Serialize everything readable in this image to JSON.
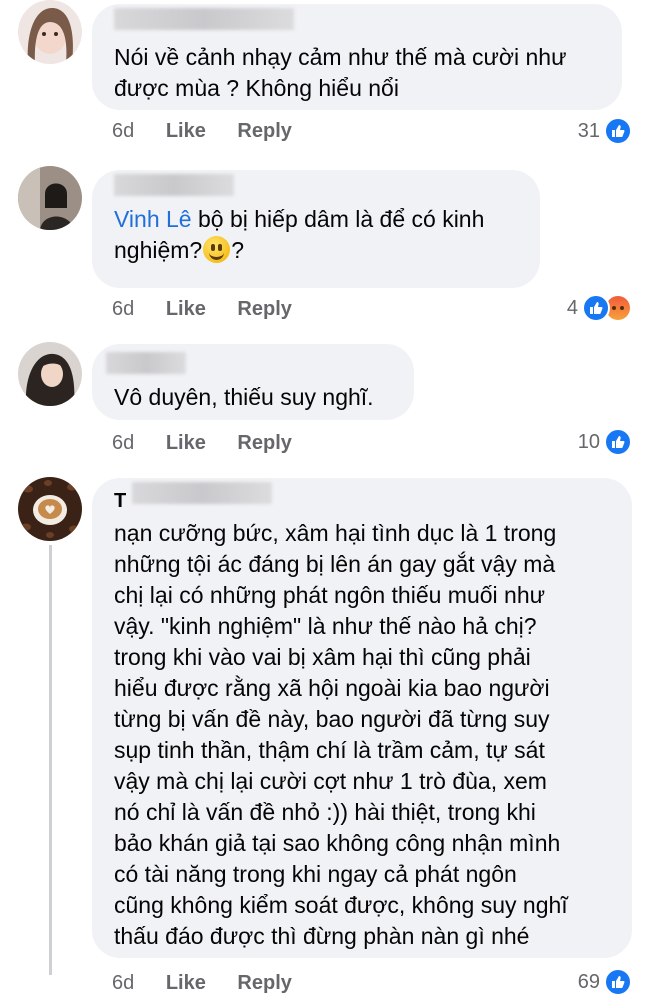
{
  "comments": [
    {
      "text": "Nói về cảnh nhạy cảm như thế mà cười như\nđược mùa ? Không hiểu nổi",
      "time": "6d",
      "like_label": "Like",
      "reply_label": "Reply",
      "reaction_count": "31"
    },
    {
      "mention": "Vinh Lê",
      "text_a": " bộ bị hiếp dâm là để có kinh\nnghiệm?",
      "text_b": "?",
      "time": "6d",
      "like_label": "Like",
      "reply_label": "Reply",
      "reaction_count": "4"
    },
    {
      "text": "Vô duyên, thiếu suy nghĩ.",
      "time": "6d",
      "like_label": "Like",
      "reply_label": "Reply",
      "reaction_count": "10"
    },
    {
      "name_initial": "T",
      "text": "nạn cưỡng bức, xâm hại tình dục là 1 trong\nnhững tội ác đáng bị lên án gay gắt vậy mà\nchị lại có những phát ngôn thiếu muối như\nvậy. \"kinh nghiệm\" là như thế nào hả chị?\ntrong khi vào vai bị xâm hại thì cũng phải\nhiểu được rằng xã hội ngoài kia bao người\ntừng bị vấn đề này, bao người đã từng suy\nsụp tinh thần, thậm chí là trầm cảm, tự sát\nvậy mà chị lại cười cợt như 1 trò đùa, xem\nnó chỉ là vấn đề nhỏ :)) hài thiệt, trong khi\nbảo khán giả tại sao không công nhận mình\ncó tài năng trong khi ngay cả phát ngôn\ncũng không kiểm soát được, không suy nghĩ\nthấu đáo được thì đừng phàn nàn gì nhé",
      "time": "6d",
      "like_label": "Like",
      "reply_label": "Reply",
      "reaction_count": "69"
    }
  ],
  "colors": {
    "bubble": "#f0f2f5",
    "mention": "#216fdb",
    "meta": "#65676b",
    "like": "#1877f2"
  }
}
